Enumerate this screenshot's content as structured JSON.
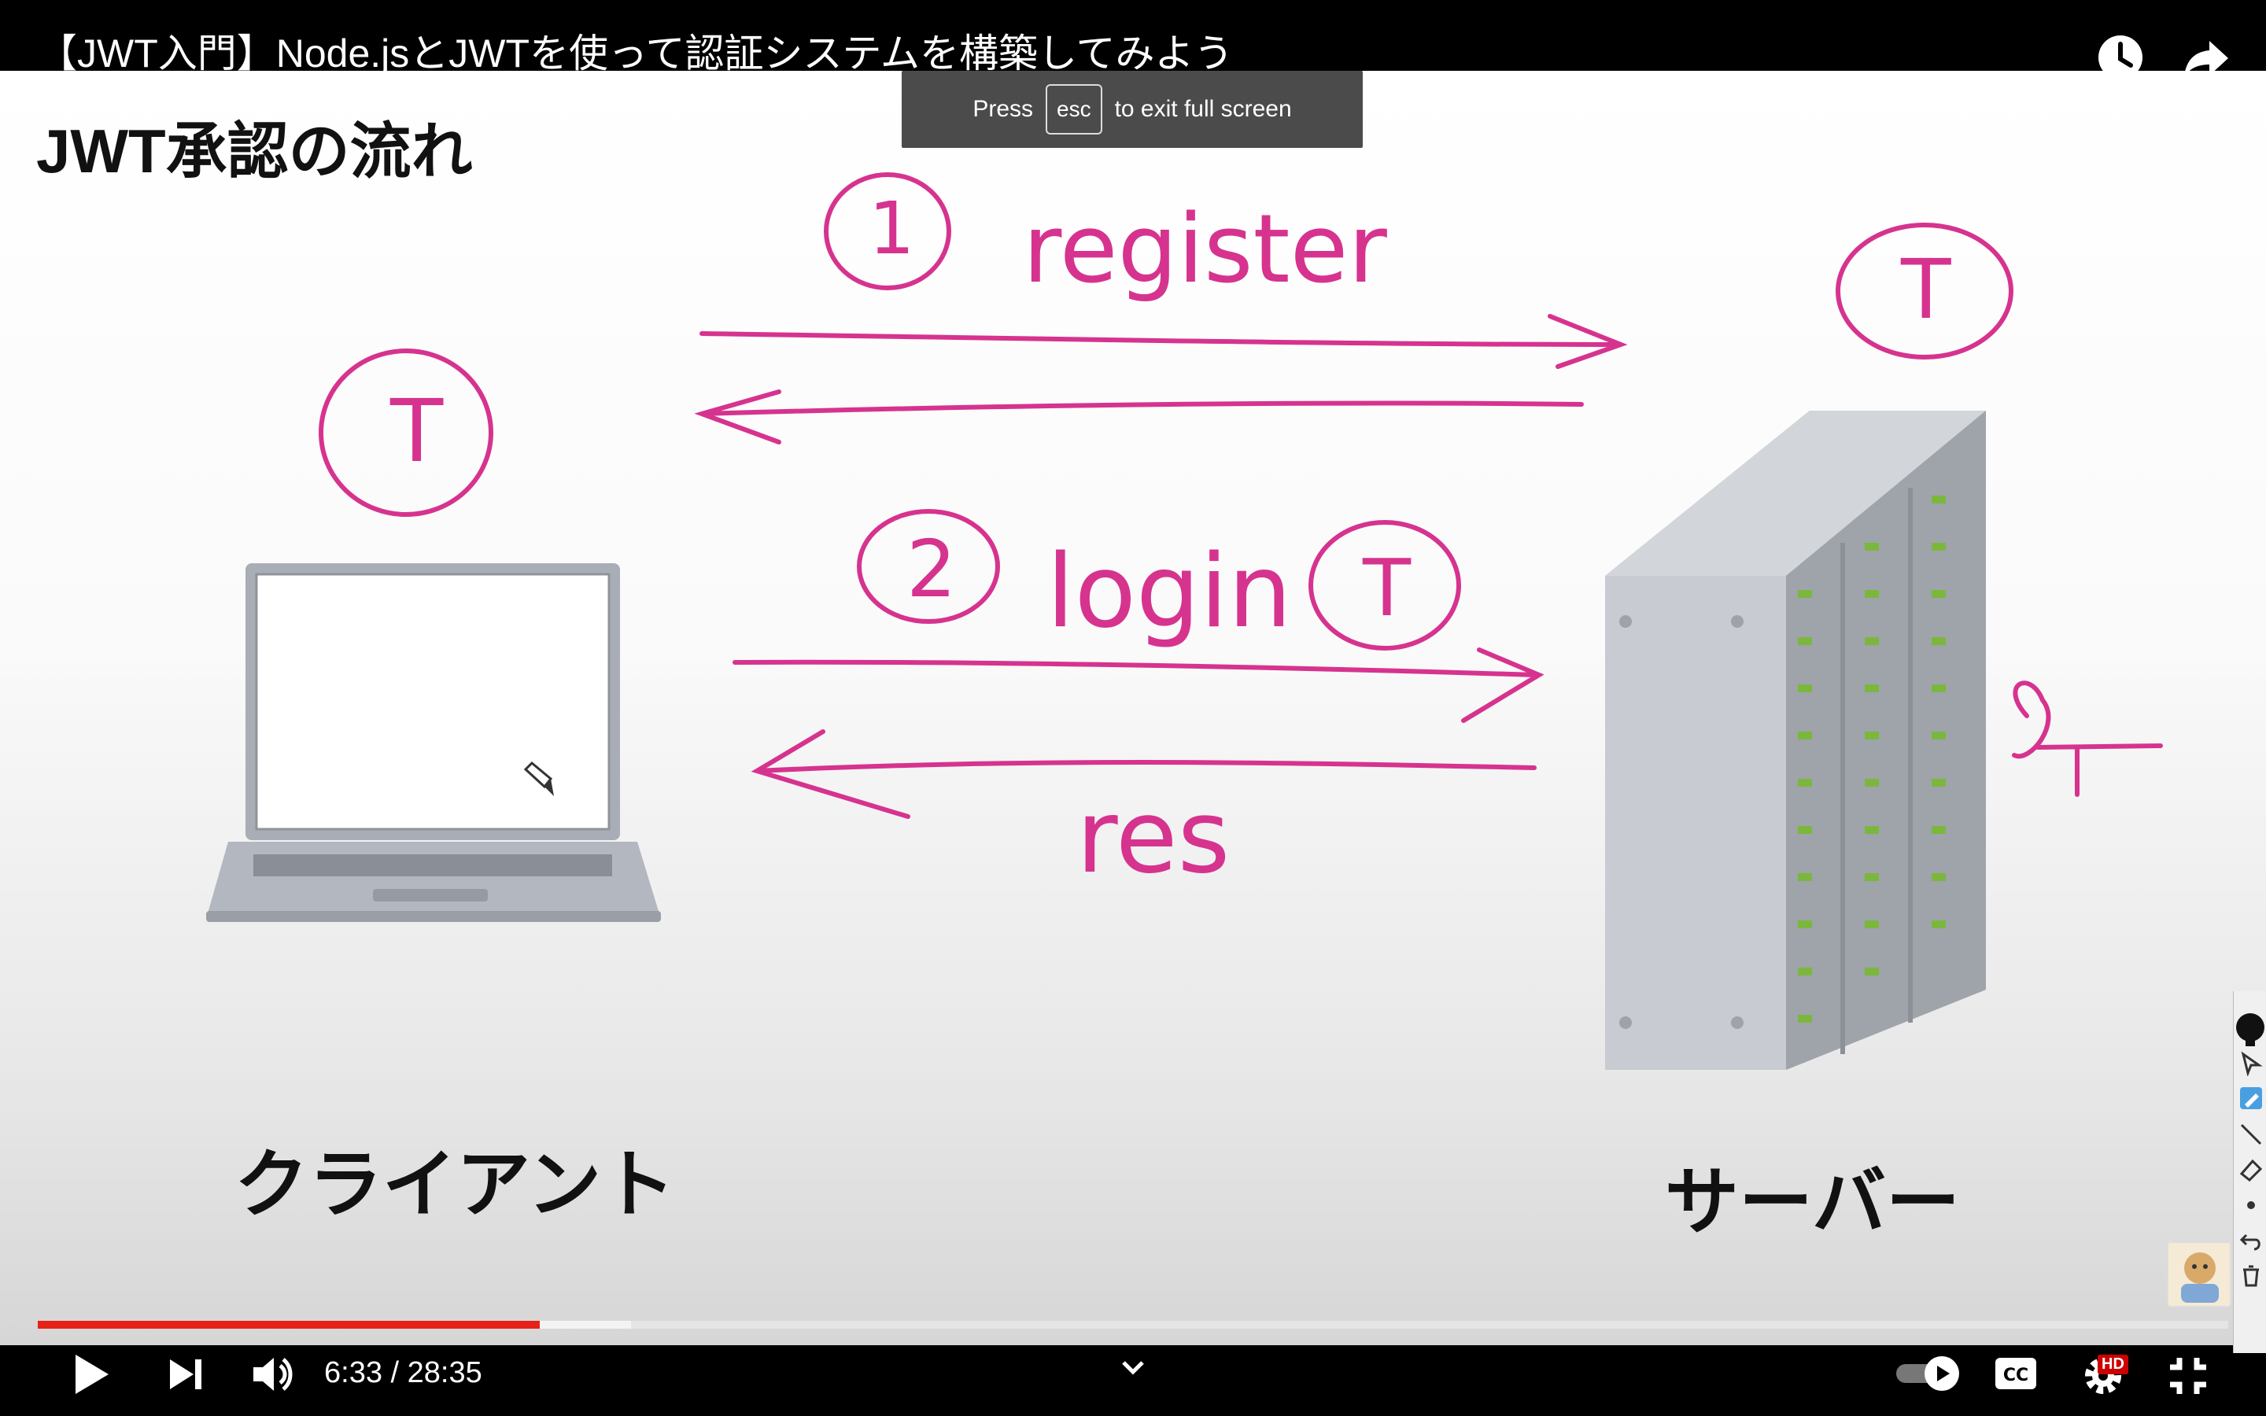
{
  "video": {
    "title": "【JWT入門】Node.jsとJWTを使って認証システムを構築してみよう"
  },
  "toast": {
    "prefix": "Press",
    "key": "esc",
    "suffix": "to exit full screen"
  },
  "slide": {
    "heading": "JWT承認の流れ",
    "client_label": "クライアント",
    "server_label": "サーバー",
    "annotations": {
      "step1_number": "1",
      "step1_word": "register",
      "step2_number": "2",
      "step2_word": "login",
      "token_letter": "T",
      "response_word": "res"
    },
    "ink_color": "#d6338f"
  },
  "player": {
    "current_time": "6:33",
    "duration": "28:35",
    "time_display": "6:33 / 28:35",
    "played_fraction": 0.229,
    "buffered_fraction": 0.271,
    "progress_color": "#e62117",
    "hd_badge": "HD",
    "icons": {
      "play": "play-icon",
      "next": "next-icon",
      "volume": "volume-icon",
      "autoplay": "autoplay-toggle-icon",
      "captions": "captions-icon",
      "settings": "settings-gear-icon",
      "exit_fullscreen": "exit-fullscreen-icon",
      "watch_later": "watch-later-clock-icon",
      "share": "share-arrow-icon",
      "chevron": "chevron-down-icon"
    }
  }
}
